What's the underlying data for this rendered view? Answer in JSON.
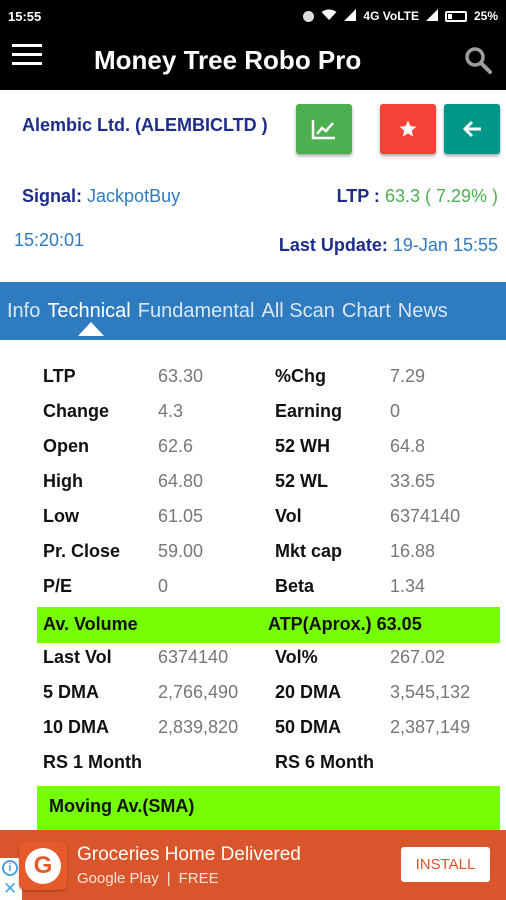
{
  "status": {
    "time": "15:55",
    "network": "4G VoLTE",
    "battery": "25%"
  },
  "appbar": {
    "title": "Money Tree Robo Pro"
  },
  "stock": {
    "name": "Alembic Ltd. (ALEMBICLTD )",
    "signal_label": "Signal:",
    "signal_value": "JackpotBuy",
    "ltp_label": "LTP :",
    "ltp_value": "63.3 ( 7.29% )",
    "time": "15:20:01",
    "last_update_label": "Last Update:",
    "last_update_value": "19-Jan 15:55"
  },
  "tabs": [
    "Info",
    "Technical",
    "Fundamental",
    "All Scan",
    "Chart",
    "News"
  ],
  "active_tab": "Technical",
  "rows": [
    {
      "l1": "LTP",
      "v1": "63.30",
      "l2": "%Chg",
      "v2": "7.29"
    },
    {
      "l1": "Change",
      "v1": "4.3",
      "l2": "Earning",
      "v2": "0"
    },
    {
      "l1": "Open",
      "v1": "62.6",
      "l2": "52 WH",
      "v2": "64.8"
    },
    {
      "l1": "High",
      "v1": "64.80",
      "l2": "52 WL",
      "v2": "33.65"
    },
    {
      "l1": "Low",
      "v1": "61.05",
      "l2": "Vol",
      "v2": "6374140"
    },
    {
      "l1": "Pr. Close",
      "v1": "59.00",
      "l2": "Mkt cap",
      "v2": "16.88"
    },
    {
      "l1": "P/E",
      "v1": "0",
      "l2": "Beta",
      "v2": "1.34"
    }
  ],
  "band1": {
    "left": "Av. Volume",
    "right": "ATP(Aprox.) 63.05"
  },
  "rows2": [
    {
      "l1": "Last Vol",
      "v1": "6374140",
      "l2": "Vol%",
      "v2": "267.02"
    },
    {
      "l1": "5 DMA",
      "v1": "2,766,490",
      "l2": "20 DMA",
      "v2": "3,545,132"
    },
    {
      "l1": "10 DMA",
      "v1": "2,839,820",
      "l2": "50 DMA",
      "v2": "2,387,149"
    },
    {
      "l1": "RS 1 Month",
      "v1": "",
      "l2": "RS 6 Month",
      "v2": ""
    }
  ],
  "band2": {
    "label": "Moving Av.(SMA)"
  },
  "ad": {
    "title": "Groceries Home Delivered",
    "store": "Google Play",
    "separator": "|",
    "price": "FREE",
    "cta": "INSTALL"
  },
  "colors": {
    "appbar": "#000000",
    "tabbar": "#2f7bbf",
    "band": "#76ff03",
    "ad": "#d9562c"
  }
}
